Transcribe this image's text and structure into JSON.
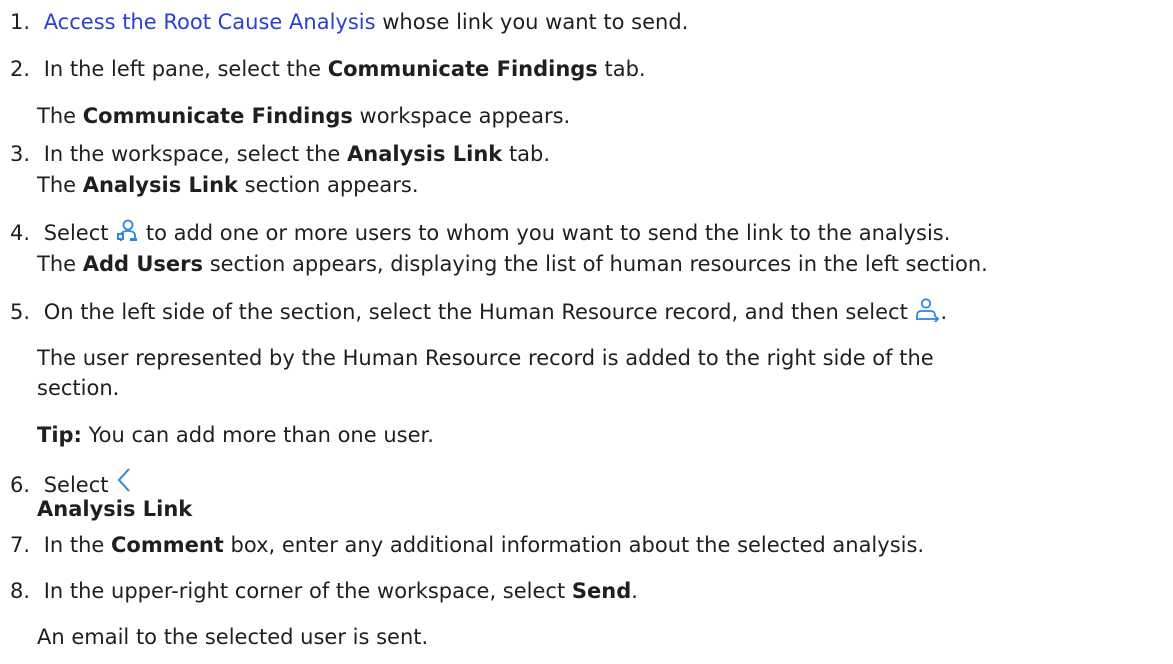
{
  "steps": [
    {
      "number": "1.",
      "link_text": "Access the Root Cause Analysis",
      "text_after": " whose link you want to send."
    },
    {
      "number": "2.",
      "text_before": "In the left pane, select the ",
      "bold": "Communicate Findings",
      "text_after": " tab.",
      "result_before": "The ",
      "result_bold": "Communicate Findings",
      "result_after": " workspace appears."
    },
    {
      "number": "3.",
      "text_before": "In the workspace, select the ",
      "bold": "Analysis Link",
      "text_after": " tab.",
      "result_before": "The ",
      "result_bold": "Analysis Link",
      "result_after": " section appears."
    },
    {
      "number": "4.",
      "text_before": "Select ",
      "icon": "add-user-icon",
      "text_after": " to add one or more users to whom you want to send the link to the analysis.",
      "result_before": "The ",
      "result_bold": "Add Users",
      "result_after": " section appears, displaying the list of human resources in the left section."
    },
    {
      "number": "5.",
      "text_before": "On the left side of the section, select the Human Resource record, and then select ",
      "icon": "move-user-right-icon",
      "text_after": ".",
      "result_line1": "The user represented by the Human Resource record is added to the right side of the",
      "result_line2": "section.",
      "tip_label": "Tip:",
      "tip_text": " You can add more than one user."
    },
    {
      "number": "6.",
      "text_before": "Select ",
      "icon": "back-chevron-icon",
      "bold_line": "Analysis Link"
    },
    {
      "number": "7.",
      "text_before": "In the ",
      "bold": "Comment",
      "text_after": " box, enter any additional information about the selected analysis."
    },
    {
      "number": "8.",
      "text_before": "In the upper-right corner of the workspace, select ",
      "bold": "Send",
      "text_after": ".",
      "result_text": "An email to the selected user is sent."
    }
  ],
  "colors": {
    "link": "#2b3fd6",
    "icon": "#2f86e0",
    "text": "#1f1f1f"
  }
}
